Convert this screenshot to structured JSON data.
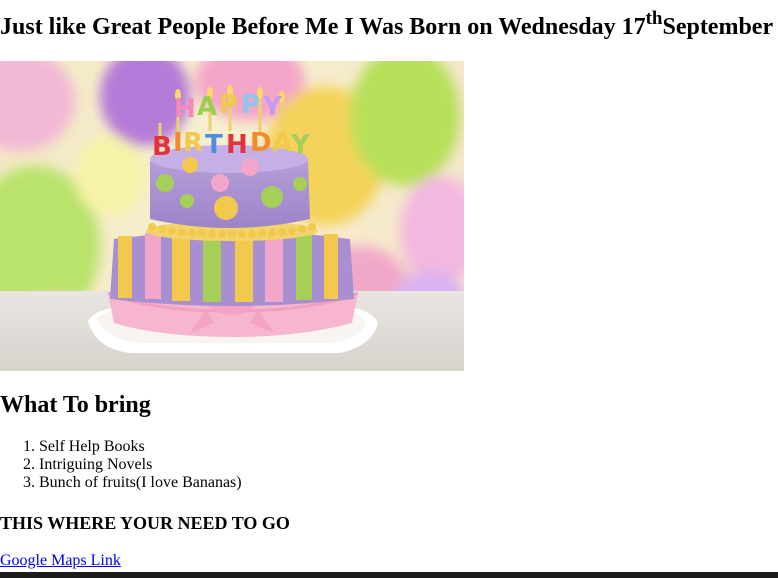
{
  "header": {
    "title_main": "Just like Great People Before Me I Was Born on Wednesday 17",
    "title_sup": "th",
    "title_end": "September"
  },
  "image": {
    "cake_topper_text": "HAPPY BIRTHDAY"
  },
  "bring": {
    "heading": "What To bring",
    "items": [
      "Self Help Books",
      "Intriguing Novels",
      "Bunch of fruits(I love Bananas)"
    ]
  },
  "location": {
    "heading": "THIS WHERE YOUR NEED TO GO",
    "link_label": "Google Maps Link"
  },
  "colors": {
    "link": "#0000ee",
    "cake_purple": "#a98fd0",
    "cake_yellow": "#f2c94c",
    "cake_green": "#a6cf5a",
    "frill_pink": "#f6b6cf"
  }
}
